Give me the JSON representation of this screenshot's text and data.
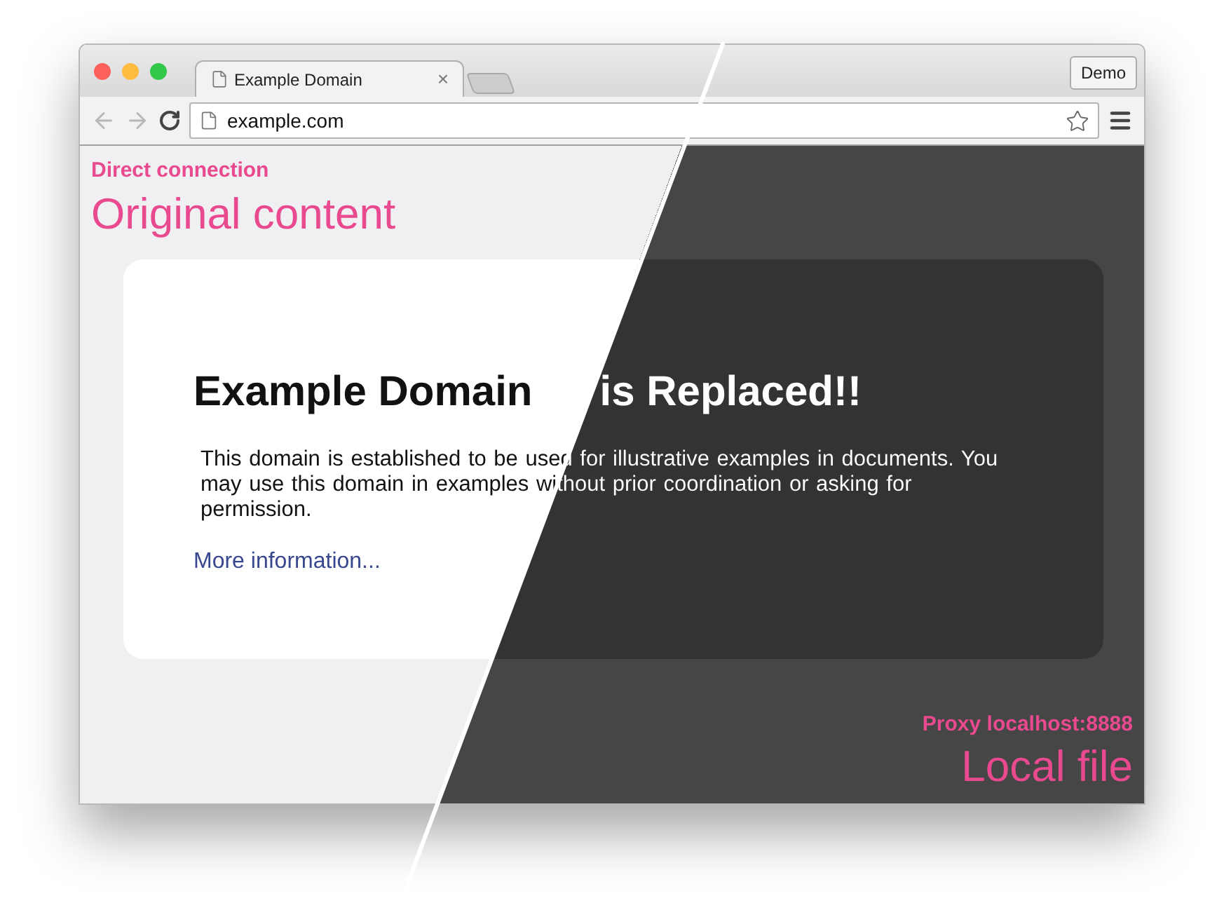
{
  "browser": {
    "tabs": [
      {
        "title": "Example Domain",
        "close": "×",
        "selected": true
      }
    ],
    "profile_button": "Demo",
    "address": "example.com"
  },
  "left": {
    "label": "Direct connection",
    "title": "Original content"
  },
  "page": {
    "heading": "Example Domain",
    "replaced_heading": "is Replaced!!",
    "paragraph": "This domain is established to be used for illustrative examples in documents. You may use this domain in examples without prior coordination or asking for permission.",
    "link": "More information..."
  },
  "right": {
    "label": "Proxy localhost:8888",
    "title": "Local file"
  }
}
